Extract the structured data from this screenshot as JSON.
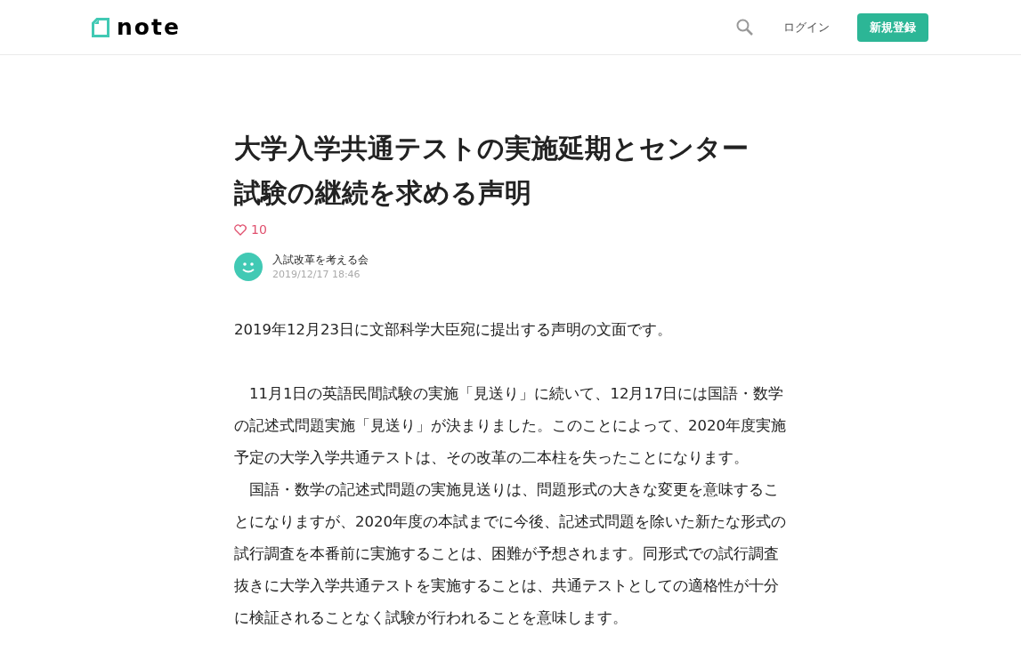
{
  "header": {
    "logo": "note",
    "login": "ログイン",
    "signup": "新規登録"
  },
  "article": {
    "title": "大学入学共通テストの実施延期とセンター試験の継続を求める声明",
    "likes": "10",
    "author": "入試改革を考える会",
    "date": "2019/12/17 18:46",
    "paragraphs": [
      "2019年12月23日に文部科学大臣宛に提出する声明の文面です。",
      "　11月1日の英語民間試験の実施「見送り」に続いて、12月17日には国語・数学の記述式問題実施「見送り」が決まりました。このことによって、2020年度実施予定の大学入学共通テストは、その改革の二本柱を失ったことになります。",
      "　国語・数学の記述式問題の実施見送りは、問題形式の大きな変更を意味することになりますが、2020年度の本試までに今後、記述式問題を除いた新たな形式の試行調査を本番前に実施することは、困難が予想されます。同形式での試行調査抜きに大学入学共通テストを実施することは、共通テストとしての適格性が十分に検証されることなく試験が行われることを意味します。"
    ]
  }
}
